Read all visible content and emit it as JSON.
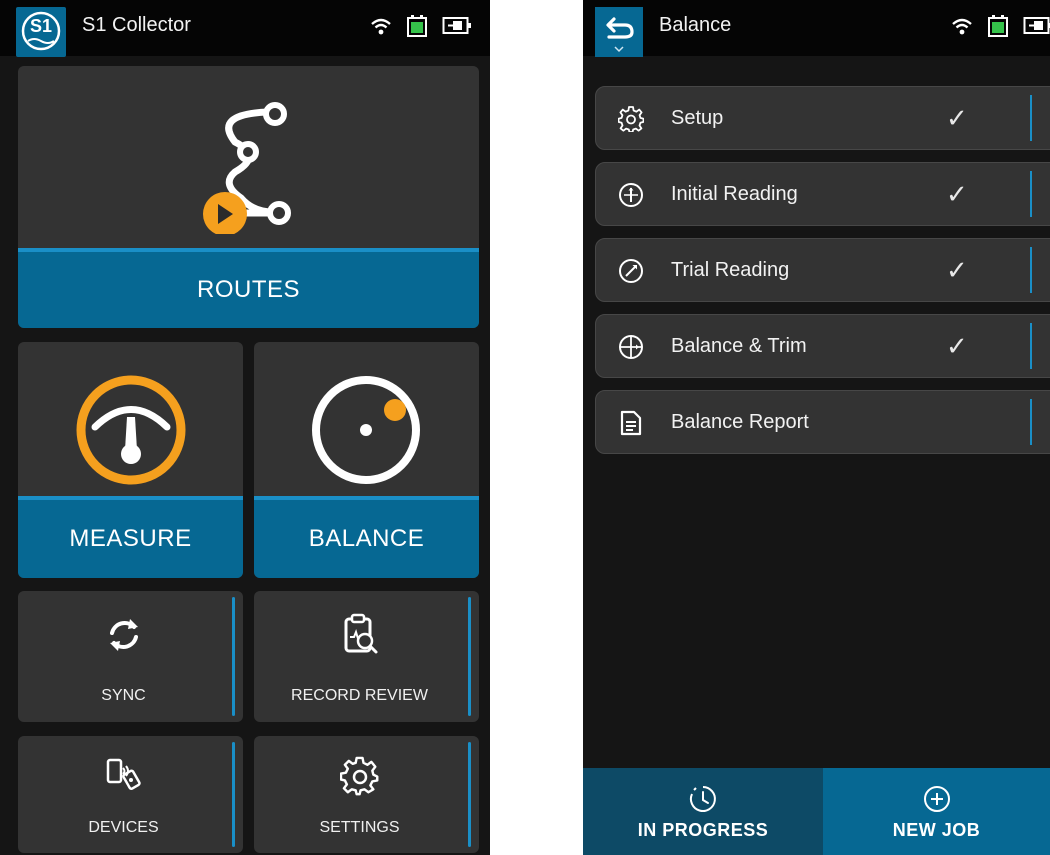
{
  "left_screen": {
    "status_bar": {
      "logo_text": "S1",
      "title": "S1 Collector"
    },
    "routes": {
      "label": "ROUTES"
    },
    "measure": {
      "label": "MEASURE"
    },
    "balance": {
      "label": "BALANCE"
    },
    "sync": {
      "label": "SYNC"
    },
    "record_review": {
      "label": "RECORD REVIEW"
    },
    "devices": {
      "label": "DEVICES"
    },
    "settings": {
      "label": "SETTINGS"
    }
  },
  "right_screen": {
    "status_bar": {
      "title": "Balance"
    },
    "items": [
      {
        "label": "Setup",
        "icon": "gear-icon",
        "done": true,
        "check": "✓"
      },
      {
        "label": "Initial Reading",
        "icon": "initial-reading-icon",
        "done": true,
        "check": "✓"
      },
      {
        "label": "Trial Reading",
        "icon": "trial-reading-icon",
        "done": true,
        "check": "✓"
      },
      {
        "label": "Balance & Trim",
        "icon": "crosshair-icon",
        "done": true,
        "check": "✓"
      },
      {
        "label": "Balance Report",
        "icon": "document-icon",
        "done": false,
        "check": ""
      }
    ],
    "bottom_tabs": {
      "in_progress": "IN PROGRESS",
      "new_job": "NEW JOB"
    }
  },
  "colors": {
    "accent_blue": "#066893",
    "accent_orange": "#f5a01e",
    "tile_bg": "#333333",
    "bg": "#151515"
  }
}
